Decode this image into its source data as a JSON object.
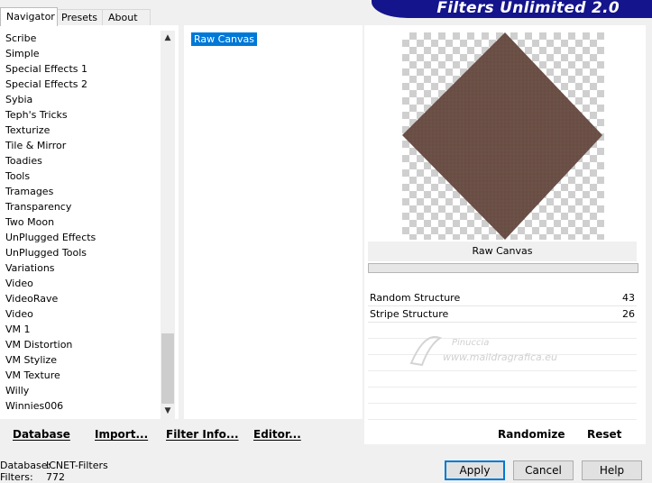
{
  "tabs": [
    "Navigator",
    "Presets",
    "About"
  ],
  "banner_title": "Filters Unlimited 2.0",
  "categories": [
    "Scribe",
    "Simple",
    "Special Effects 1",
    "Special Effects 2",
    "Sybia",
    "Teph's Tricks",
    "Texturize",
    "Tile & Mirror",
    "Toadies",
    "Tools",
    "Tramages",
    "Transparency",
    "Two Moon",
    "UnPlugged Effects",
    "UnPlugged Tools",
    "Variations",
    "Video",
    "VideoRave",
    "Video",
    "VM 1",
    "VM Distortion",
    "VM Stylize",
    "VM Texture",
    "Willy",
    "Winnies006"
  ],
  "filters": [
    "Raw Canvas"
  ],
  "preview": {
    "filter_name": "Raw Canvas",
    "fill_color": "#6e5249"
  },
  "params": [
    {
      "name": "Random Structure",
      "value": "43"
    },
    {
      "name": "Stripe Structure",
      "value": "26"
    }
  ],
  "watermark": {
    "line1": "Pinuccia",
    "line2": "www.maildragrafica.eu"
  },
  "buttons": {
    "database": "Database",
    "import": "Import...",
    "filter_info": "Filter Info...",
    "editor": "Editor...",
    "randomize": "Randomize",
    "reset": "Reset",
    "apply": "Apply",
    "cancel": "Cancel",
    "help": "Help"
  },
  "status": {
    "database_label": "Database:",
    "database_value": "ICNET-Filters",
    "filters_label": "Filters:",
    "filters_value": "772"
  },
  "icons": {
    "scroll_up": "▲",
    "scroll_down": "▼"
  }
}
